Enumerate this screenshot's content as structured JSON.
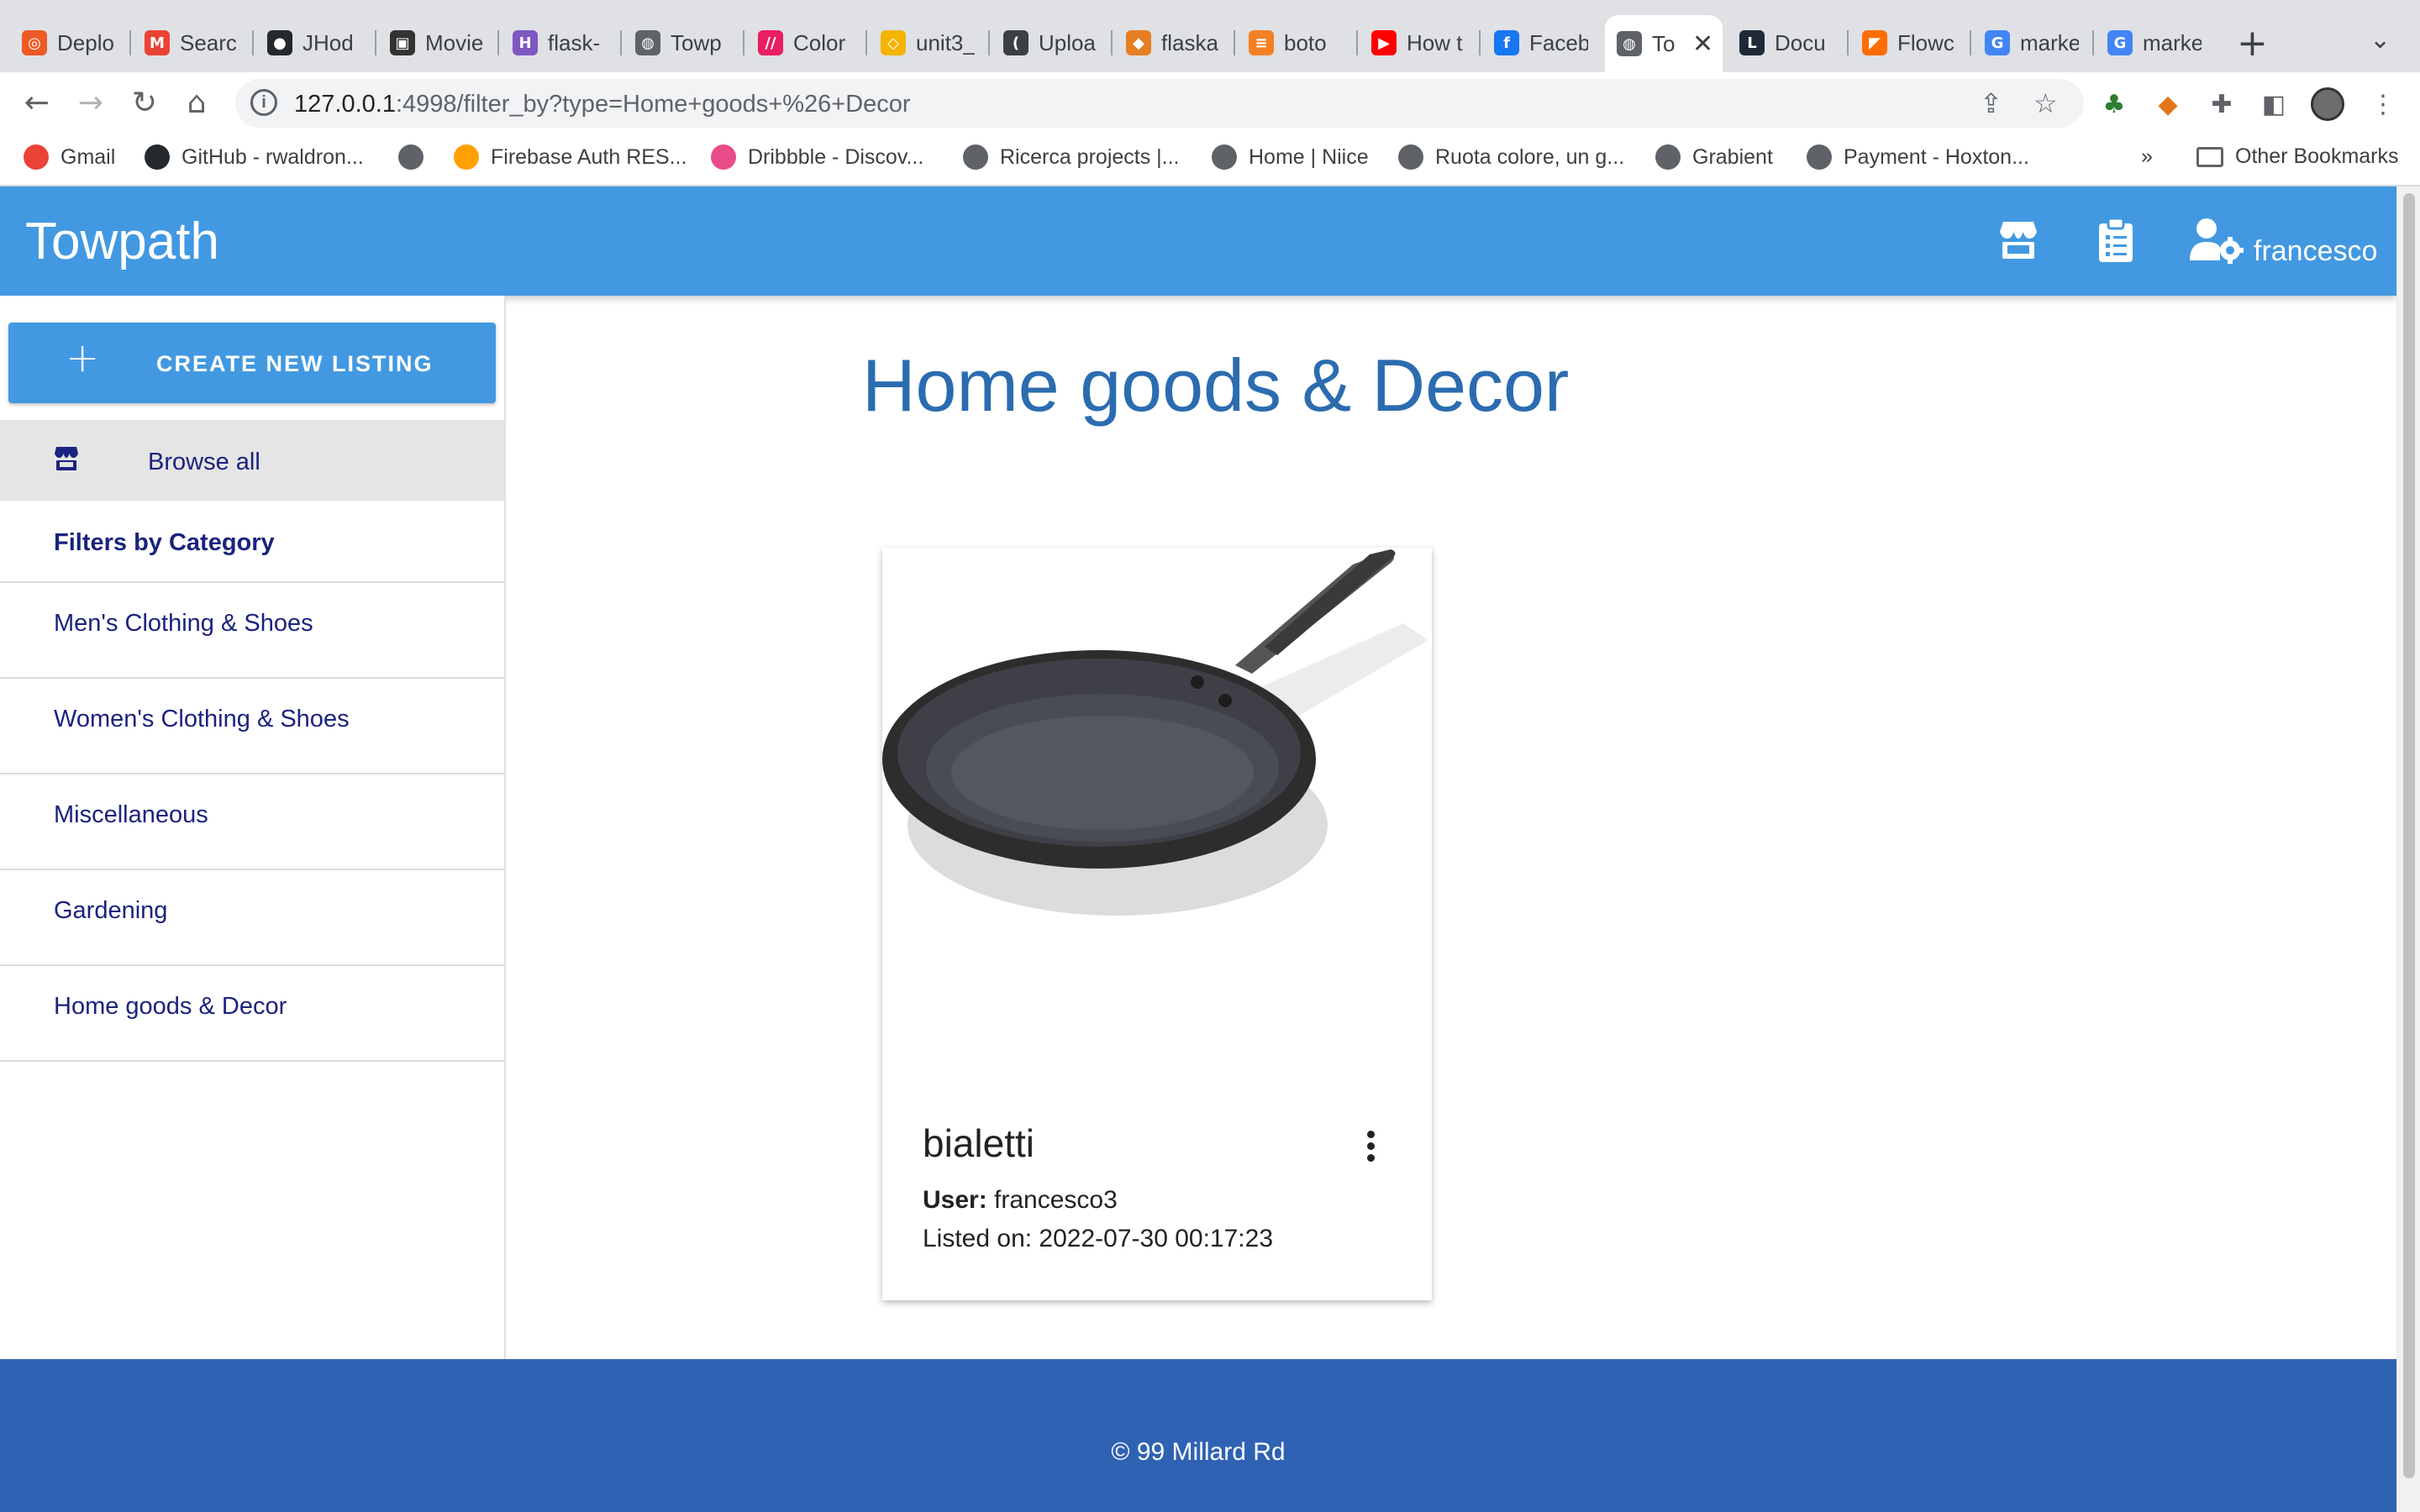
{
  "browser": {
    "tabs": [
      {
        "title": "Deplo",
        "color": "#ee5a24",
        "glyph": "◎"
      },
      {
        "title": "Searc",
        "color": "#ea4335",
        "glyph": "M"
      },
      {
        "title": "JHod",
        "color": "#24292e",
        "glyph": "●"
      },
      {
        "title": "Movie",
        "color": "#333333",
        "glyph": "▣"
      },
      {
        "title": "flask-",
        "color": "#7e57c2",
        "glyph": "H"
      },
      {
        "title": "Towp",
        "color": "#5f6368",
        "glyph": "◍"
      },
      {
        "title": "Color",
        "color": "#e91e63",
        "glyph": "//"
      },
      {
        "title": "unit3_",
        "color": "#f4b400",
        "glyph": "◇"
      },
      {
        "title": "Uploa",
        "color": "#3c4043",
        "glyph": "("
      },
      {
        "title": "flaska",
        "color": "#e67e22",
        "glyph": "◆"
      },
      {
        "title": "boto",
        "color": "#f48024",
        "glyph": "≡"
      },
      {
        "title": "How t",
        "color": "#ff0000",
        "glyph": "▶"
      },
      {
        "title": "Faceb",
        "color": "#1877f2",
        "glyph": "f"
      },
      {
        "title": "To",
        "color": "#5f6368",
        "glyph": "◍",
        "active": true
      },
      {
        "title": "Docu",
        "color": "#1f2937",
        "glyph": "L"
      },
      {
        "title": "Flowc",
        "color": "#ff6d00",
        "glyph": "◤"
      },
      {
        "title": "marke",
        "color": "#4285f4",
        "glyph": "G"
      },
      {
        "title": "marke",
        "color": "#4285f4",
        "glyph": "G"
      }
    ],
    "tab_close": "✕",
    "new_tab": "+",
    "url_host": "127.0.0.1",
    "url_rest": ":4998/filter_by?type=Home+goods+%26+Decor",
    "bookmarks": [
      {
        "label": "Gmail",
        "color": "#ea4335"
      },
      {
        "label": "GitHub - rwaldron...",
        "color": "#24292e"
      },
      {
        "label": "",
        "color": "#5f6368"
      },
      {
        "label": "Firebase Auth RES...",
        "color": "#ffa000"
      },
      {
        "label": "Dribbble - Discov...",
        "color": "#ea4c89"
      },
      {
        "label": "Ricerca projects |...",
        "color": "#5f6368"
      },
      {
        "label": "Home | Niice",
        "color": "#5f6368"
      },
      {
        "label": "Ruota colore, un g...",
        "color": "#5f6368"
      },
      {
        "label": "Grabient",
        "color": "#5f6368"
      },
      {
        "label": "Payment - Hoxton...",
        "color": "#5f6368"
      }
    ],
    "bookmarks_more": "»",
    "other_bookmarks": "Other Bookmarks"
  },
  "app": {
    "brand": "Towpath",
    "username": "francesco",
    "accent": "#4299e1",
    "icons": [
      "store-icon",
      "clipboard-list-icon",
      "user-settings-icon"
    ]
  },
  "sidebar": {
    "create_label": "CREATE NEW LISTING",
    "create_plus": "+",
    "browse_all": "Browse all",
    "filters_heading": "Filters by Category",
    "categories": [
      "Men's Clothing & Shoes",
      "Women's Clothing & Shoes",
      "Miscellaneous",
      "Gardening",
      "Home goods & Decor"
    ]
  },
  "main": {
    "title": "Home goods & Decor",
    "listings": [
      {
        "name": "bialetti",
        "user_label": "User:",
        "user": "francesco3",
        "listed_on": "Listed on: 2022-07-30 00:17:23"
      }
    ]
  },
  "footer": {
    "text": "© 99 Millard Rd"
  }
}
